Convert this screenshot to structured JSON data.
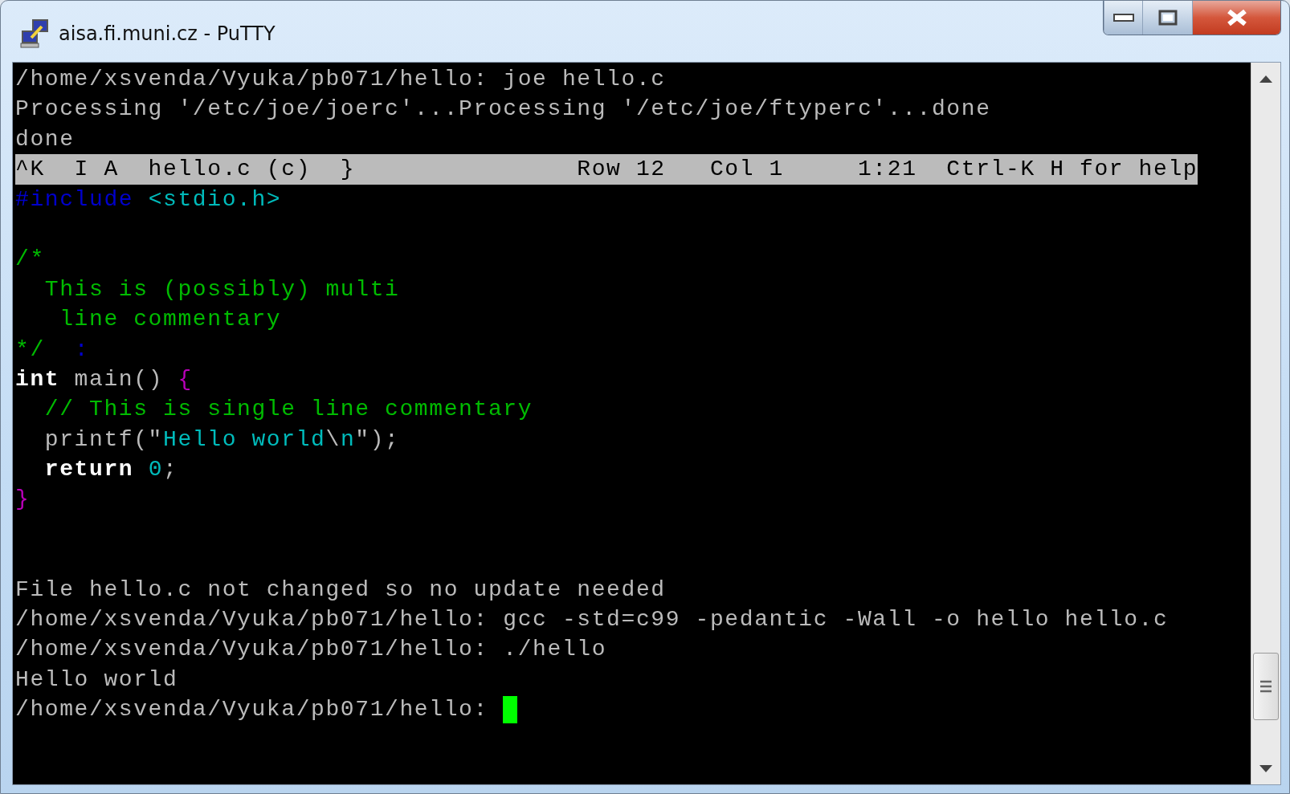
{
  "window": {
    "title": "aisa.fi.muni.cz - PuTTY"
  },
  "terminal": {
    "cursor": true,
    "lines": [
      {
        "kind": "text",
        "segments": [
          {
            "kind": "plain",
            "text": "/home/xsvenda/Vyuka/pb071/hello: joe hello.c"
          }
        ]
      },
      {
        "kind": "text",
        "segments": [
          {
            "kind": "plain",
            "text": "Processing '/etc/joe/joerc'...Processing '/etc/joe/ftyperc'...done"
          }
        ]
      },
      {
        "kind": "text",
        "segments": [
          {
            "kind": "plain",
            "text": "done"
          }
        ]
      },
      {
        "kind": "status",
        "segments": [
          {
            "kind": "plain",
            "text": "^K  I A  hello.c (c)  }               Row 12   Col 1     1:21  Ctrl-K H for help"
          }
        ]
      },
      {
        "kind": "text",
        "segments": [
          {
            "kind": "preprocessor",
            "text": "#include"
          },
          {
            "kind": "string",
            "text": " <stdio.h>"
          }
        ]
      },
      {
        "kind": "blank"
      },
      {
        "kind": "text",
        "segments": [
          {
            "kind": "comment",
            "text": "/*"
          }
        ]
      },
      {
        "kind": "text",
        "segments": [
          {
            "kind": "comment",
            "text": "  This is (possibly) multi"
          }
        ]
      },
      {
        "kind": "text",
        "segments": [
          {
            "kind": "comment",
            "text": "   line commentary"
          }
        ]
      },
      {
        "kind": "text",
        "segments": [
          {
            "kind": "comment",
            "text": "*/  "
          },
          {
            "kind": "preprocessor",
            "text": ":"
          }
        ]
      },
      {
        "kind": "text",
        "segments": [
          {
            "kind": "bold",
            "text": "int"
          },
          {
            "kind": "plain",
            "text": " main() "
          },
          {
            "kind": "brace",
            "text": "{"
          }
        ]
      },
      {
        "kind": "text",
        "segments": [
          {
            "kind": "comment",
            "text": "  // This is single line commentary"
          }
        ]
      },
      {
        "kind": "text",
        "segments": [
          {
            "kind": "plain",
            "text": "  printf(\""
          },
          {
            "kind": "string",
            "text": "Hello world"
          },
          {
            "kind": "plain",
            "text": "\\"
          },
          {
            "kind": "string",
            "text": "n"
          },
          {
            "kind": "plain",
            "text": "\");"
          }
        ]
      },
      {
        "kind": "text",
        "segments": [
          {
            "kind": "bold",
            "text": "  return"
          },
          {
            "kind": "string",
            "text": " 0"
          },
          {
            "kind": "plain",
            "text": ";"
          }
        ]
      },
      {
        "kind": "text",
        "segments": [
          {
            "kind": "brace",
            "text": "}"
          }
        ]
      },
      {
        "kind": "blank"
      },
      {
        "kind": "blank"
      },
      {
        "kind": "text",
        "segments": [
          {
            "kind": "plain",
            "text": "File hello.c not changed so no update needed"
          }
        ]
      },
      {
        "kind": "text",
        "segments": [
          {
            "kind": "plain",
            "text": "/home/xsvenda/Vyuka/pb071/hello: gcc -std=c99 -pedantic -Wall -o hello hello.c"
          }
        ]
      },
      {
        "kind": "text",
        "segments": [
          {
            "kind": "plain",
            "text": "/home/xsvenda/Vyuka/pb071/hello: ./hello"
          }
        ]
      },
      {
        "kind": "text",
        "segments": [
          {
            "kind": "plain",
            "text": "Hello world"
          }
        ]
      },
      {
        "kind": "text",
        "segments": [
          {
            "kind": "plain",
            "text": "/home/xsvenda/Vyuka/pb071/hello: "
          }
        ]
      }
    ]
  }
}
